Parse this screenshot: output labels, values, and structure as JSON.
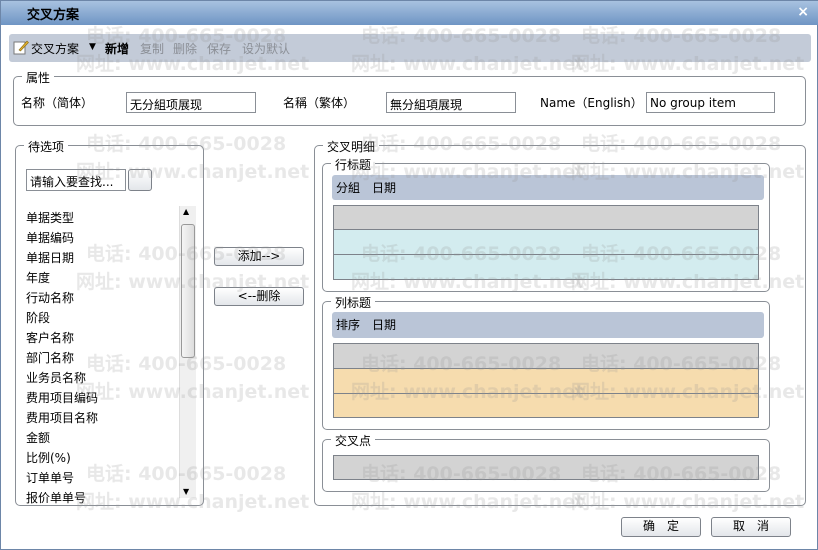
{
  "window": {
    "title": "交叉方案",
    "close": "×"
  },
  "toolbar": {
    "scheme": "交叉方案",
    "new": "新增",
    "copy": "复制",
    "delete": "删除",
    "save": "保存",
    "set_default": "设为默认"
  },
  "properties": {
    "legend": "属性",
    "simplified_label": "名称（简体）",
    "simplified_value": "无分組项展现",
    "traditional_label": "名稱（繁体）",
    "traditional_value": "無分組項展現",
    "english_label": "Name（English）",
    "english_value": "No group item"
  },
  "candidates": {
    "legend": "待选项",
    "search_placeholder": "请输入要查找...",
    "items": [
      "单据类型",
      "单据编码",
      "单据日期",
      "年度",
      "行动名称",
      "阶段",
      "客户名称",
      "部门名称",
      "业务员名称",
      "费用项目编码",
      "费用项目名称",
      "金额",
      "比例(%)",
      "订单单号",
      "报价单单号"
    ]
  },
  "actions": {
    "add": "添加-->",
    "remove": "<--删除"
  },
  "detail": {
    "legend": "交叉明细",
    "row_header": {
      "legend": "行标题",
      "fields": "分組　日期"
    },
    "col_header": {
      "legend": "列标题",
      "fields": "排序　日期"
    },
    "cross_point": {
      "legend": "交叉点"
    }
  },
  "footer": {
    "ok": "确　定",
    "cancel": "取　消"
  },
  "watermark": {
    "phone": "电话: 400-665-0028",
    "site": "网址: www.chanjet.net"
  },
  "colors": {
    "row_gray": "#d3d3d3",
    "row_cyan": "#d3ecef",
    "row_orange": "#f6dcae",
    "band": "#bac5d7"
  }
}
